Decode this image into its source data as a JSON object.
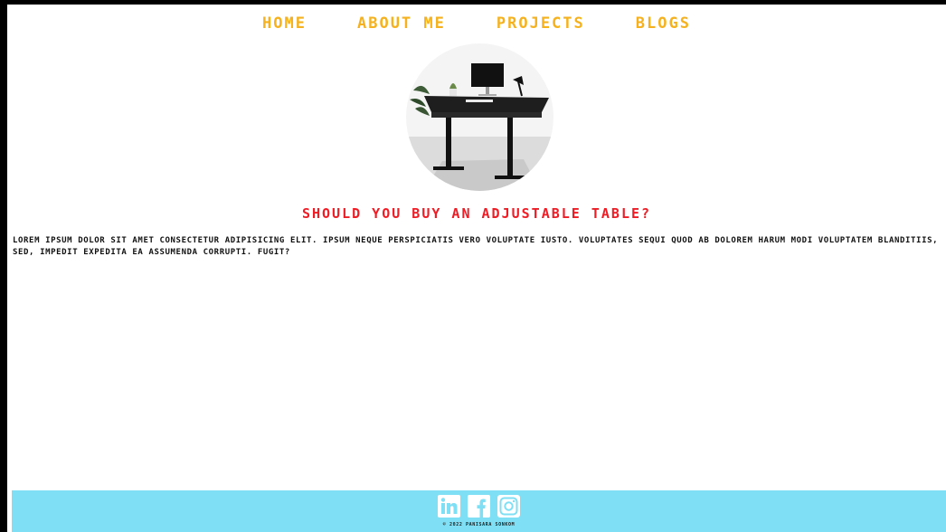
{
  "nav": {
    "items": [
      {
        "label": "HOME"
      },
      {
        "label": "ABOUT ME"
      },
      {
        "label": "PROJECTS"
      },
      {
        "label": "BLOGS"
      }
    ]
  },
  "hero": {
    "icon": "standing-desk-photo"
  },
  "article": {
    "title": "SHOULD YOU BUY AN ADJUSTABLE TABLE?",
    "body": "LOREM IPSUM DOLOR SIT AMET CONSECTETUR ADIPISICING ELIT. IPSUM NEQUE PERSPICIATIS VERO VOLUPTATE IUSTO. VOLUPTATES SEQUI QUOD AB DOLOREM HARUM MODI VOLUPTATEM BLANDITIIS, SED, IMPEDIT EXPEDITA EA ASSUMENDA CORRUPTI. FUGIT?"
  },
  "footer": {
    "socials": [
      {
        "icon": "linkedin-icon"
      },
      {
        "icon": "facebook-icon"
      },
      {
        "icon": "instagram-icon"
      }
    ],
    "copyright": "© 2022 PANISARA SONKOM"
  },
  "colors": {
    "nav": "#f5b21e",
    "title": "#ee1c25",
    "footer_bg": "#7fe0f5"
  }
}
